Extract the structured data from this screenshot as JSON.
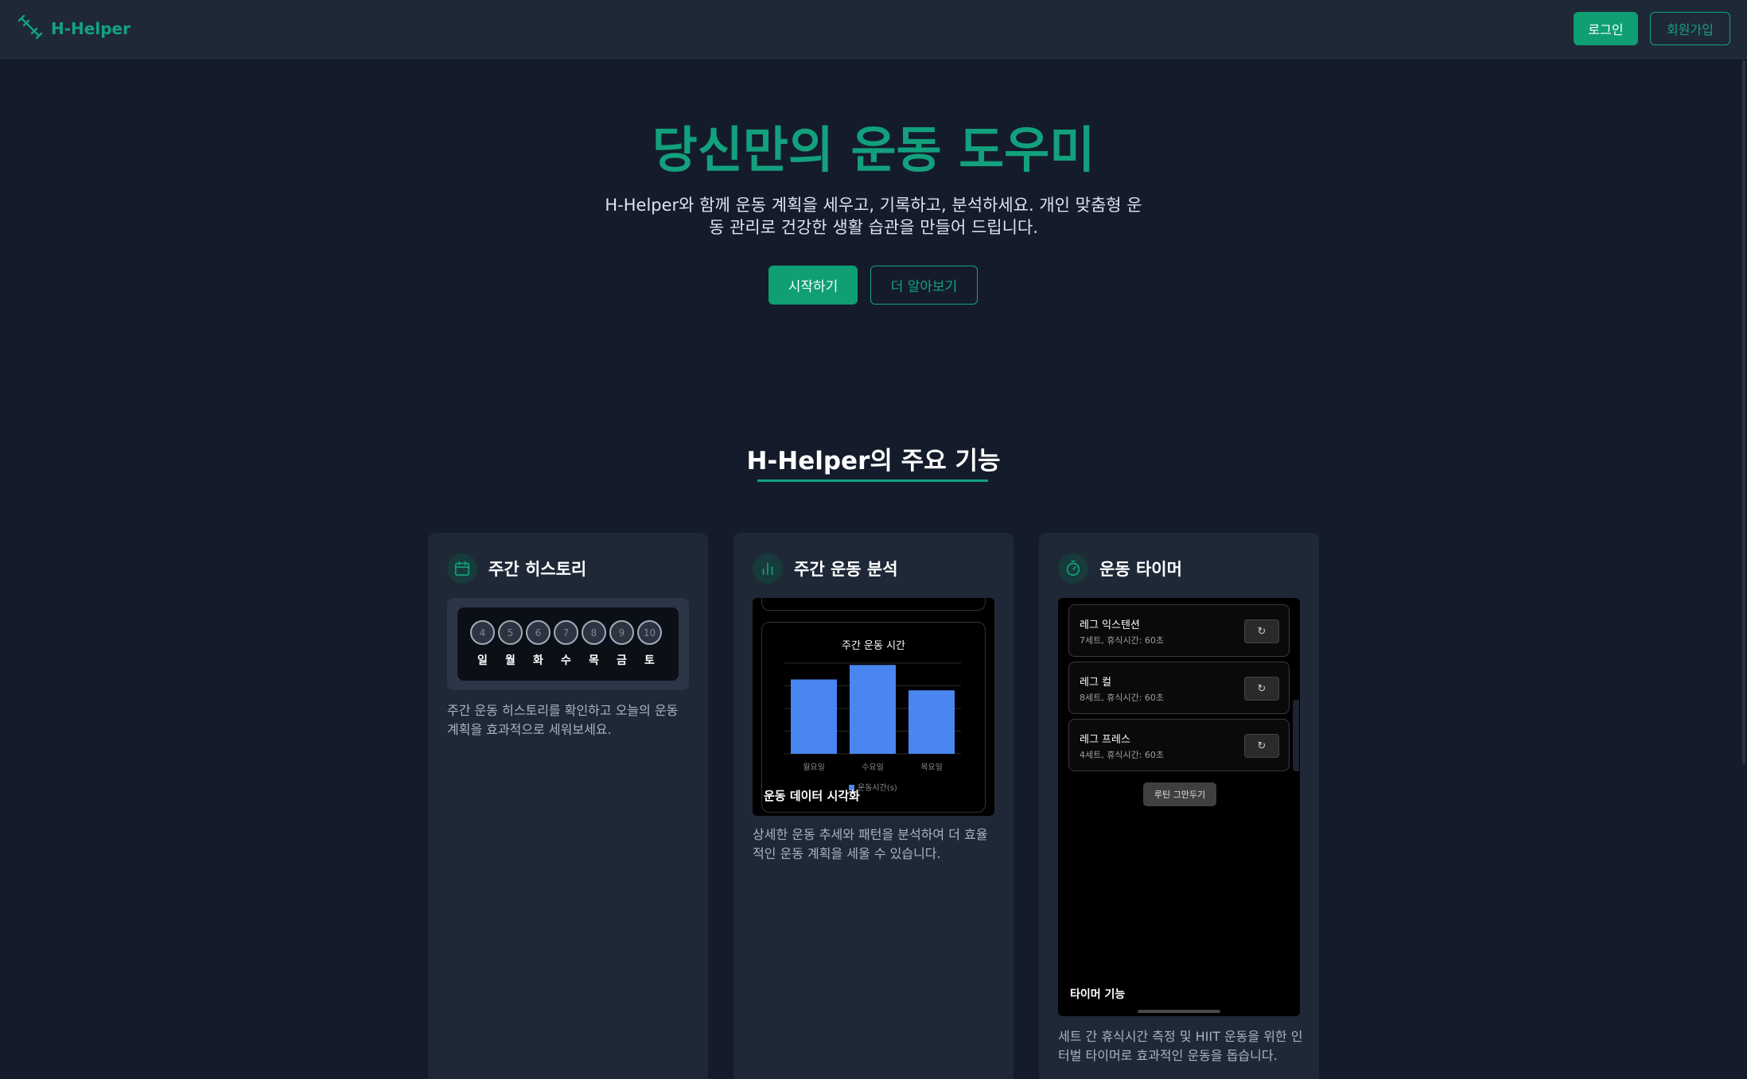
{
  "nav": {
    "brand": "H-Helper",
    "login": "로그인",
    "signup": "회원가입"
  },
  "hero": {
    "title": "당신만의 운동 도우미",
    "description": "H-Helper와 함께 운동 계획을 세우고, 기록하고, 분석하세요. 개인 맞춤형 운동 관리로 건강한 생활 습관을 만들어 드립니다.",
    "start": "시작하기",
    "more": "더 알아보기"
  },
  "features": {
    "title": "H-Helper의 주요 기능",
    "cards": [
      {
        "title": "주간 히스토리",
        "description": "주간 운동 히스토리를 확인하고 오늘의 운동 계획을 효과적으로 세워보세요.",
        "days": [
          {
            "num": "4",
            "name": "일"
          },
          {
            "num": "5",
            "name": "월"
          },
          {
            "num": "6",
            "name": "화"
          },
          {
            "num": "7",
            "name": "수"
          },
          {
            "num": "8",
            "name": "목"
          },
          {
            "num": "9",
            "name": "금"
          },
          {
            "num": "10",
            "name": "토"
          }
        ]
      },
      {
        "title": "주간 운동 분석",
        "description": "상세한 운동 추세와 패턴을 분석하여 더 효율적인 운동 계획을 세울 수 있습니다.",
        "preview_caption": "운동 데이터 시각화"
      },
      {
        "title": "운동 타이머",
        "description": "세트 간 휴식시간 측정 및 HIIT 운동을 위한 인터벌 타이머로 효과적인 운동을 돕습니다.",
        "preview_caption": "타이머 기능",
        "routines": [
          {
            "name": "레그 익스텐션",
            "meta": "7세트, 휴식시간: 60초"
          },
          {
            "name": "레그 컬",
            "meta": "8세트, 휴식시간: 60초"
          },
          {
            "name": "레그 프레스",
            "meta": "4세트, 휴식시간: 60초"
          }
        ],
        "make_routine": "루틴 그만두기"
      }
    ]
  },
  "colors": {
    "accent": "#12a37f",
    "background": "#141c2b",
    "card": "#1f2837",
    "bar": "#4a86f0"
  },
  "chart_data": {
    "type": "bar",
    "title": "주간 운동 시간",
    "categories": [
      "월요일",
      "수요일",
      "목요일"
    ],
    "series": [
      {
        "name": "운동시간(s)",
        "values": [
          82,
          98,
          70
        ]
      }
    ],
    "ylim": [
      0,
      100
    ],
    "grid": true,
    "legend": "bottom"
  }
}
